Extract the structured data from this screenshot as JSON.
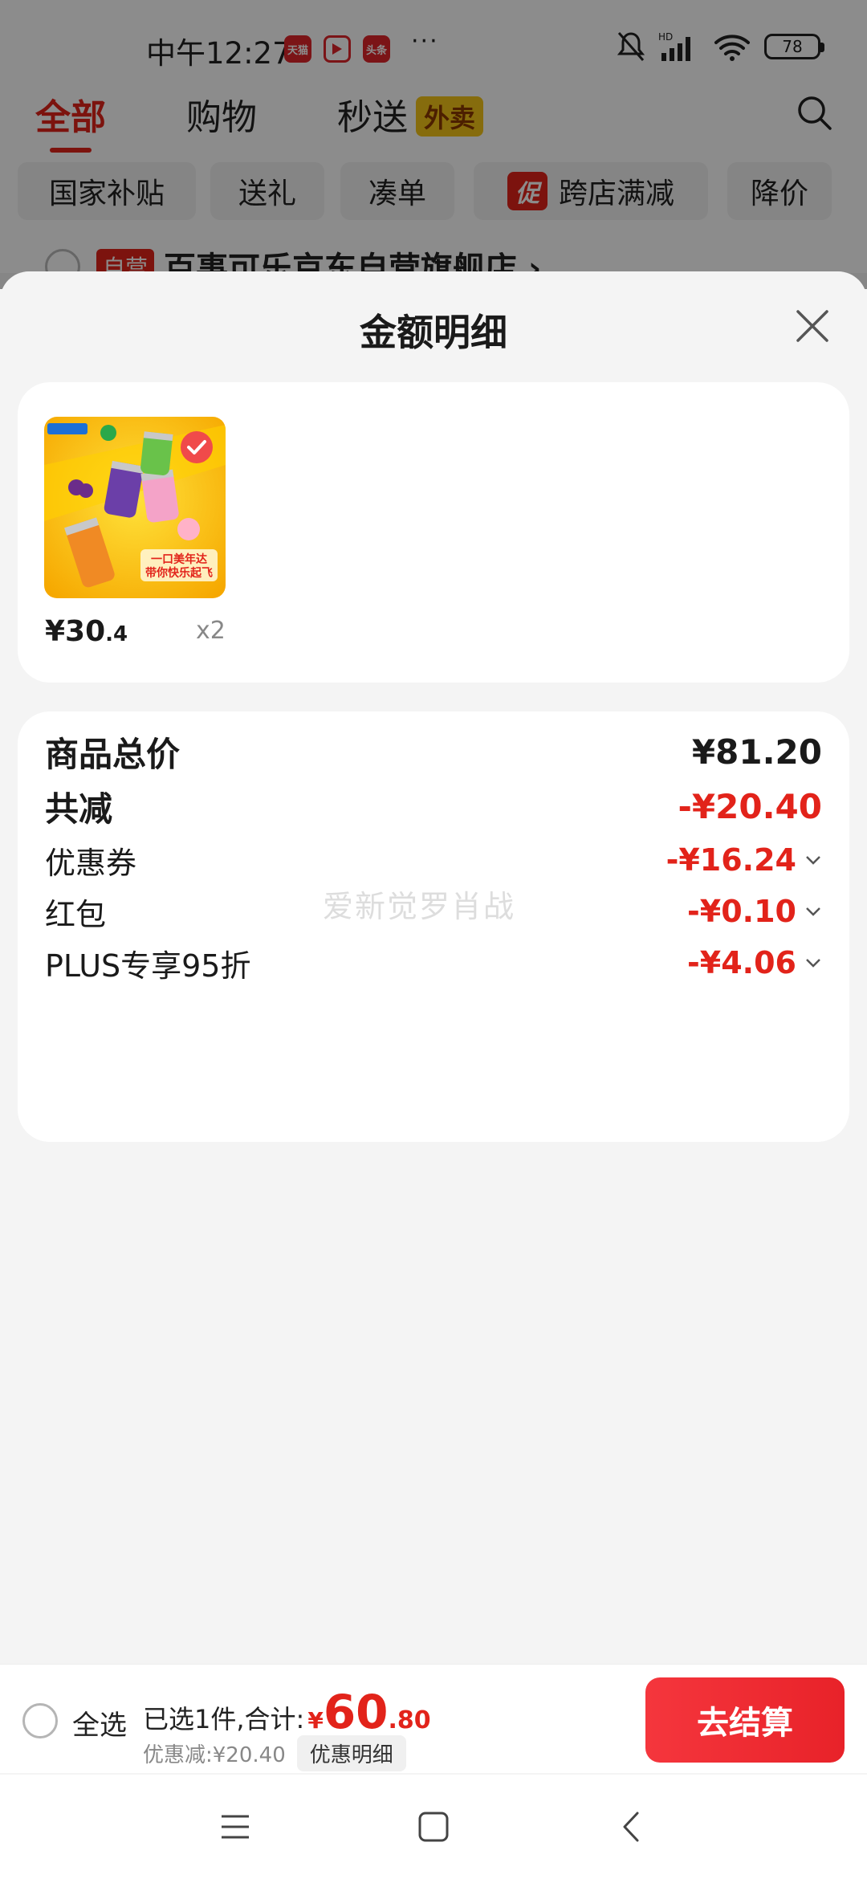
{
  "status_bar": {
    "time": "中午12:27",
    "app_badges": [
      "天猫",
      "",
      "头条"
    ],
    "more": "···",
    "network": "HD",
    "battery": "78"
  },
  "top_tabs": [
    {
      "label": "全部"
    },
    {
      "label": "购物"
    },
    {
      "label": "秒送"
    }
  ],
  "waimai_tag": "外卖",
  "filters": [
    "国家补贴",
    "送礼",
    "凑单",
    "跨店满减",
    "降价"
  ],
  "promo_tag": "促",
  "store": {
    "tag": "自营",
    "name": "百事可乐京东自营旗舰店 ›"
  },
  "sheet": {
    "title": "金额明细",
    "product": {
      "price_int": "¥30",
      "price_dec": ".4",
      "qty": "x2",
      "img_line1": "一口美年达",
      "img_line2": "带你快乐起飞"
    },
    "summary": {
      "total_label": "商品总价",
      "total_value": "¥81.20",
      "reduce_label": "共减",
      "reduce_value": "-¥20.40",
      "items": [
        {
          "label": "优惠券",
          "value": "-¥16.24"
        },
        {
          "label": "红包",
          "value": "-¥0.10"
        },
        {
          "label": "PLUS专享95折",
          "value": "-¥4.06"
        }
      ]
    },
    "watermark": "爱新觉罗肖战"
  },
  "bottom_bar": {
    "select_all": "全选",
    "selected_text": "已选1件,合计:",
    "currency": "¥",
    "total_int": "60",
    "total_dec": ".80",
    "discount_text": "优惠减:¥20.40",
    "detail_label": "优惠明细",
    "checkout_label": "去结算"
  },
  "colors": {
    "accent_red": "#e2231a",
    "sheet_bg": "#f4f4f4",
    "waimai_yellow": "#f5c518"
  }
}
